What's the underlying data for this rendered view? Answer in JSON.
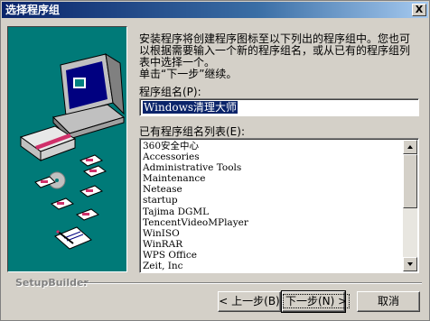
{
  "window": {
    "title": "选择程序组",
    "close_glyph": "X"
  },
  "intro": {
    "lines": [
      "安装程序将创建程序图标至以下列出的程序组中。您也可",
      "以根据需要输入一个新的程序组名，或从已有的程序组列",
      "表中选择一个。",
      "单击“下一步”继续。"
    ]
  },
  "program_group": {
    "label": "程序组名(P):",
    "value": "Windows清理大师"
  },
  "existing_groups": {
    "label": "已有程序组名列表(E):",
    "items": [
      "360安全中心",
      "Accessories",
      "Administrative Tools",
      "Maintenance",
      "Netease",
      "startup",
      "Tajima DGML",
      "TencentVideoMPlayer",
      "WinISO",
      "WinRAR",
      "WPS Office",
      "Zeit, Inc"
    ]
  },
  "branding": "SetupBuilder",
  "buttons": {
    "back": "< 上一步(B)",
    "next": "下一步(N) >",
    "cancel": "取消"
  },
  "colors": {
    "title_bar": "#0a246a",
    "illustration_bg": "#007a78",
    "selection": "#0a246a",
    "dialog_face": "#d4d0c8"
  }
}
